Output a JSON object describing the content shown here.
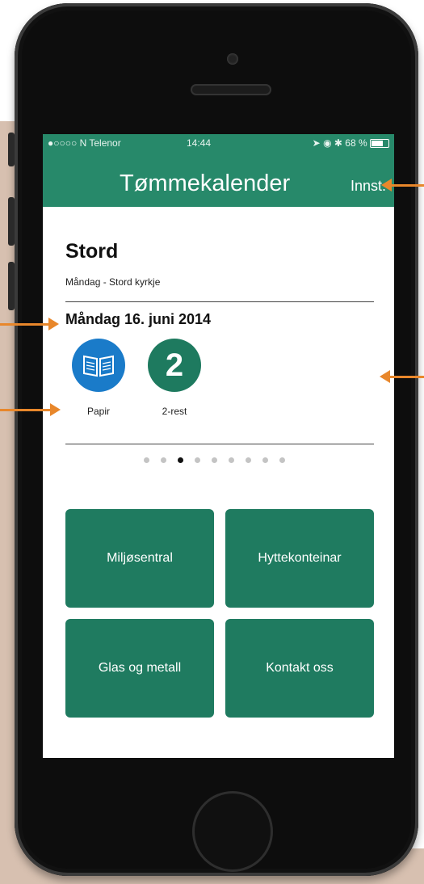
{
  "status_bar": {
    "carrier": "●○○○○ N Telenor",
    "time": "14:44",
    "battery": "68 %"
  },
  "nav": {
    "title": "Tømmekalender",
    "settings_label": "Innst."
  },
  "location": {
    "name": "Stord",
    "route": "Måndag - Stord kyrkje"
  },
  "pickup": {
    "date": "Måndag 16. juni 2014",
    "items": [
      {
        "label": "Papir",
        "icon": "book-icon"
      },
      {
        "label": "2-rest",
        "badge": "2"
      }
    ]
  },
  "pager": {
    "count": 9,
    "active": 2
  },
  "tiles": [
    {
      "label": "Miljøsentral"
    },
    {
      "label": "Hyttekonteinar"
    },
    {
      "label": "Glas og metall"
    },
    {
      "label": "Kontakt oss"
    }
  ],
  "colors": {
    "accent": "#27896a",
    "tile": "#1f7b60",
    "paper": "#1a7bc9",
    "callout": "#e8872b"
  }
}
